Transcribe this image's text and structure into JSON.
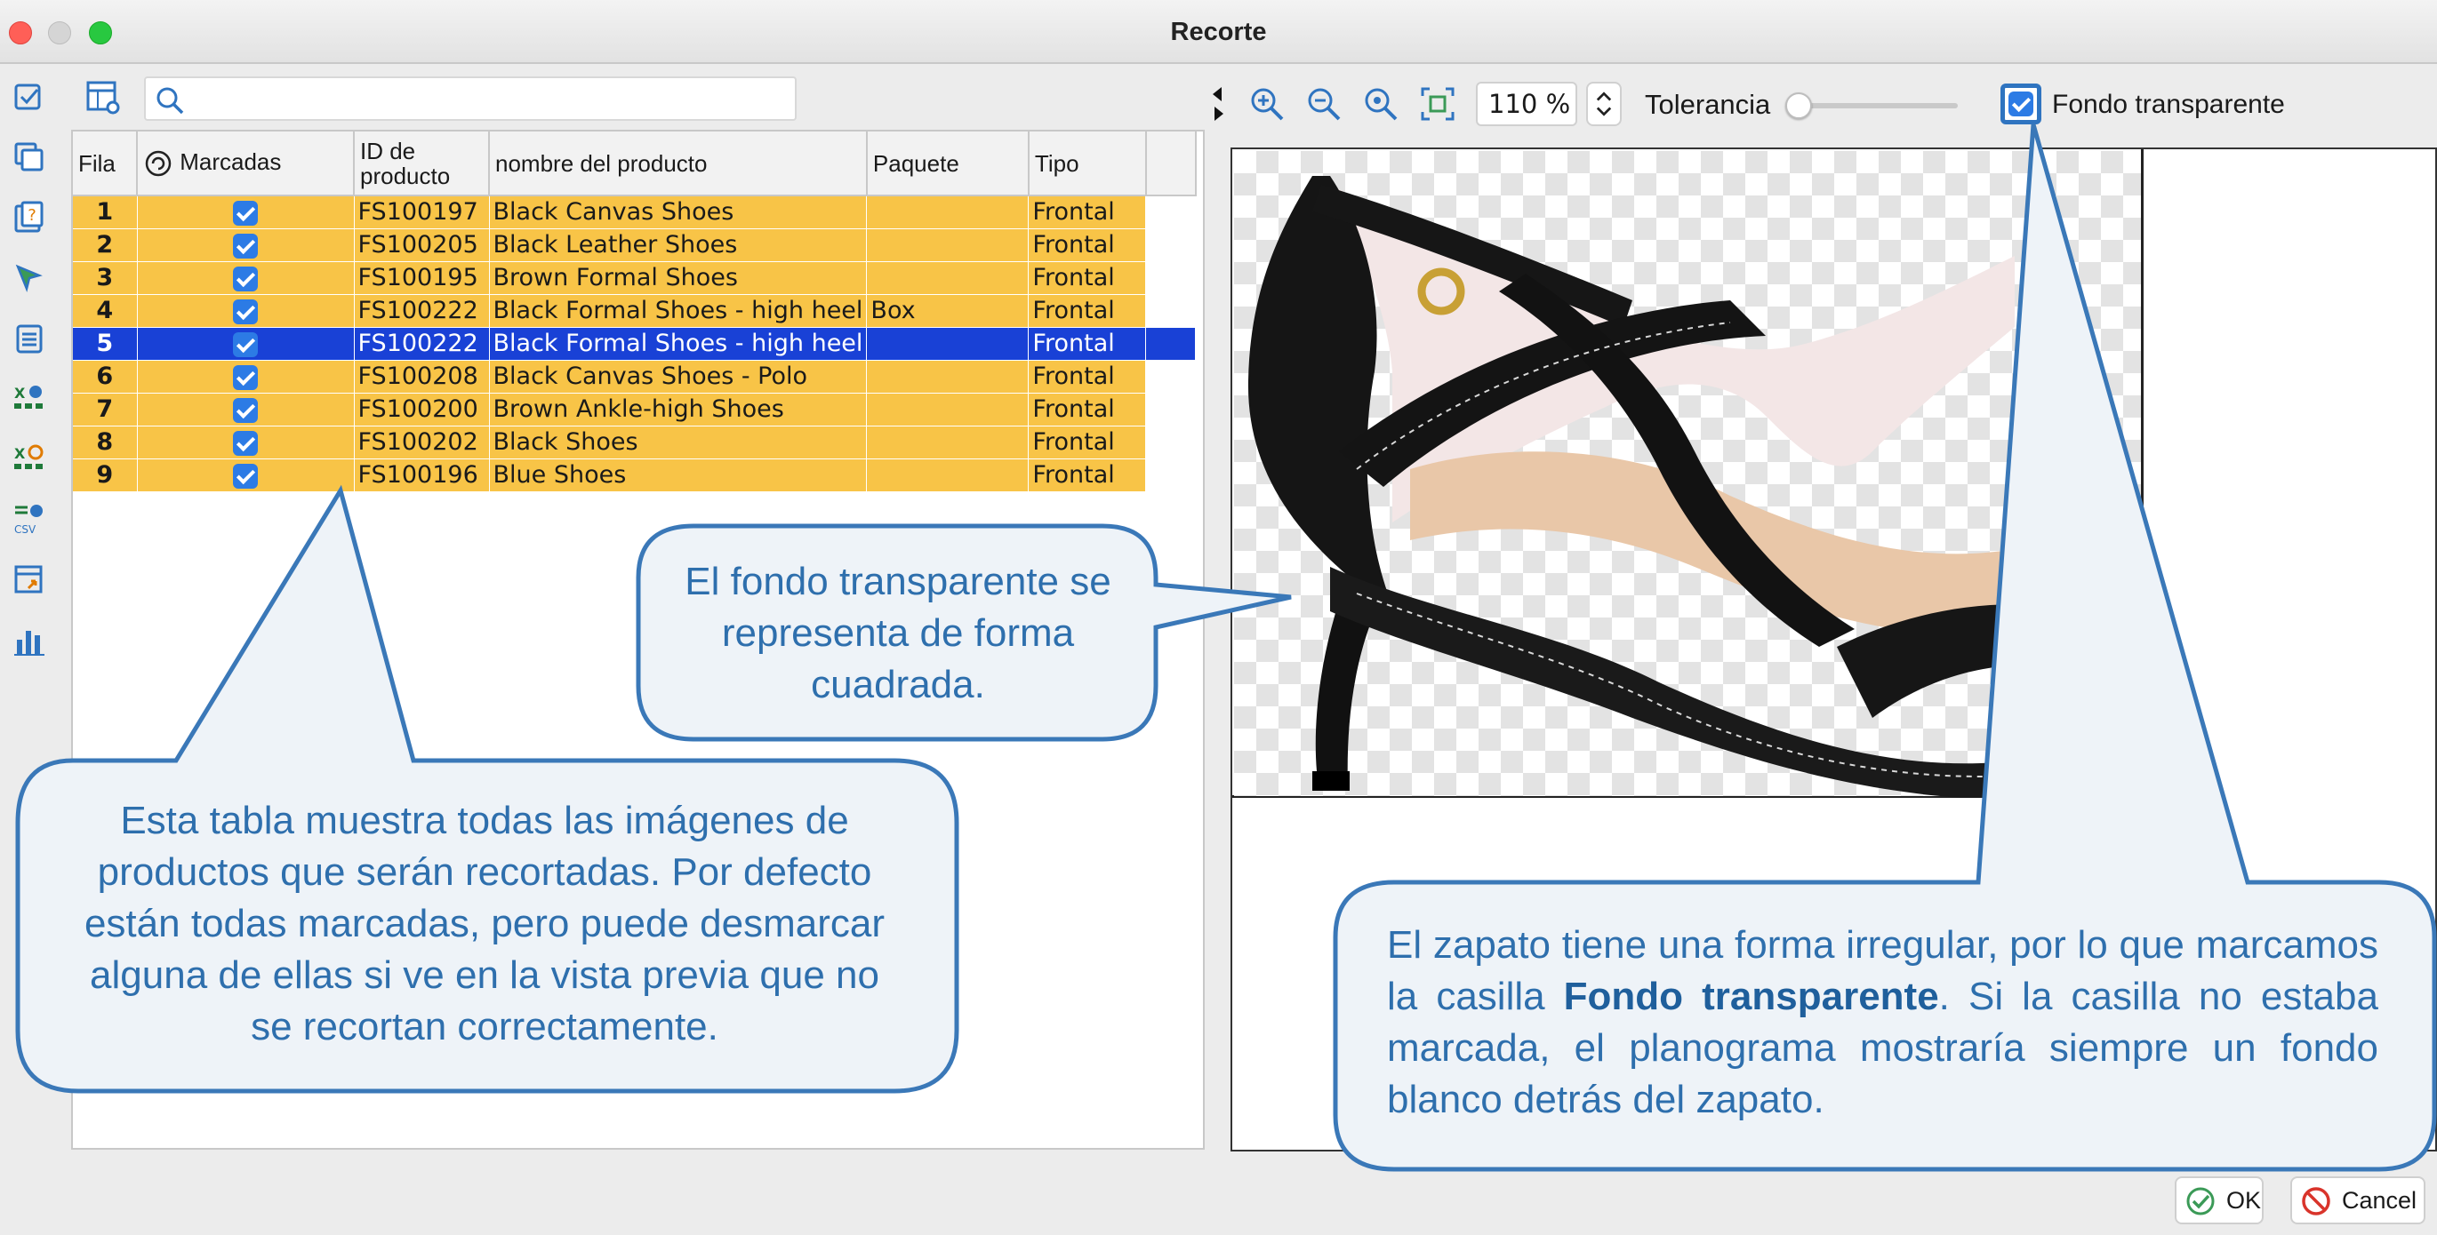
{
  "window": {
    "title": "Recorte"
  },
  "toolbar": {
    "search_placeholder": "",
    "zoom_value": "110 %",
    "tolerance_label": "Tolerancia",
    "tolerance_level": 0,
    "transparent_label": "Fondo transparente",
    "transparent_checked": true
  },
  "table": {
    "headers": {
      "fila": "Fila",
      "marcadas": "Marcadas",
      "id_line1": "ID de",
      "id_line2": "producto",
      "nombre": "nombre del producto",
      "paquete": "Paquete",
      "tipo": "Tipo"
    },
    "rows": [
      {
        "fila": "1",
        "checked": true,
        "id": "FS100197",
        "nombre": "Black Canvas Shoes",
        "paquete": "",
        "tipo": "Frontal"
      },
      {
        "fila": "2",
        "checked": true,
        "id": "FS100205",
        "nombre": "Black Leather Shoes",
        "paquete": "",
        "tipo": "Frontal"
      },
      {
        "fila": "3",
        "checked": true,
        "id": "FS100195",
        "nombre": "Brown Formal Shoes",
        "paquete": "",
        "tipo": "Frontal"
      },
      {
        "fila": "4",
        "checked": true,
        "id": "FS100222",
        "nombre": "Black Formal Shoes - high heel",
        "paquete": "Box",
        "tipo": "Frontal"
      },
      {
        "fila": "5",
        "checked": true,
        "id": "FS100222",
        "nombre": "Black Formal Shoes - high heel",
        "paquete": "",
        "tipo": "Frontal"
      },
      {
        "fila": "6",
        "checked": true,
        "id": "FS100208",
        "nombre": "Black Canvas Shoes - Polo",
        "paquete": "",
        "tipo": "Frontal"
      },
      {
        "fila": "7",
        "checked": true,
        "id": "FS100200",
        "nombre": "Brown Ankle-high Shoes",
        "paquete": "",
        "tipo": "Frontal"
      },
      {
        "fila": "8",
        "checked": true,
        "id": "FS100202",
        "nombre": "Black Shoes",
        "paquete": "",
        "tipo": "Frontal"
      },
      {
        "fila": "9",
        "checked": true,
        "id": "FS100196",
        "nombre": "Blue Shoes",
        "paquete": "",
        "tipo": "Frontal"
      }
    ],
    "selected_row": 4
  },
  "callouts": {
    "table_note": "Esta tabla muestra todas las imágenes de productos que serán recortadas. Por defecto están todas marcadas, pero puede desmarcar alguna de ellas si ve en la vista previa que no se recortan correctamente.",
    "checker_note": "El fondo transparente se representa de forma cuadrada.",
    "shoe_note_before": "El zapato tiene una forma irregular, por lo que marcamos la casilla ",
    "shoe_note_bold": "Fondo transparente",
    "shoe_note_after": ". Si la casilla no estaba marcada, el planograma mostraría siempre un fondo blanco detrás del zapato."
  },
  "buttons": {
    "ok": "OK",
    "cancel": "Cancel"
  },
  "icons": {
    "rail": [
      "check-list-icon",
      "copy-icon",
      "help-doc-icon",
      "cursor-select-icon",
      "clipboard-list-icon",
      "excel-import-icon",
      "excel-settings-icon",
      "csv-import-icon",
      "table-transfer-icon",
      "bar-chart-icon"
    ],
    "zoom": [
      "zoom-in-icon",
      "zoom-out-icon",
      "zoom-reset-icon",
      "fit-screen-icon"
    ]
  },
  "colors": {
    "row_highlight": "#f8c447",
    "row_selected": "#1941d6",
    "callout_border": "#3a78b8",
    "callout_fill": "#eef3f8",
    "callout_text": "#2e6fad",
    "checkbox_blue": "#2c7be5"
  }
}
